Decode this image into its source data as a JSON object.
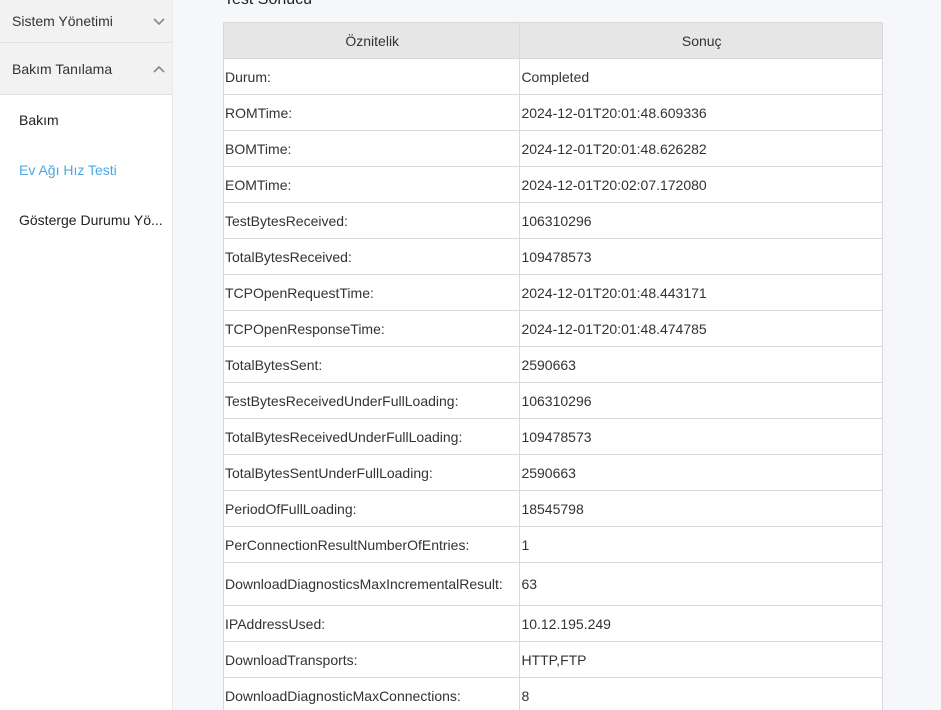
{
  "sidebar": {
    "groups": [
      {
        "label": "Sistem Yönetimi",
        "expanded": false,
        "icon": "chevron-down-icon"
      },
      {
        "label": "Bakım Tanılama",
        "expanded": true,
        "icon": "chevron-up-icon"
      }
    ],
    "items": [
      {
        "label": "Bakım",
        "active": false
      },
      {
        "label": "Ev Ağı Hız Testi",
        "active": true
      },
      {
        "label": "Gösterge Durumu Yö..."
      }
    ]
  },
  "main": {
    "section_title": "Test Sonucu",
    "table": {
      "headers": [
        "Öznitelik",
        "Sonuç"
      ],
      "rows": [
        {
          "attr": "Durum:",
          "value": "Completed"
        },
        {
          "attr": "ROMTime:",
          "value": "2024-12-01T20:01:48.609336"
        },
        {
          "attr": "BOMTime:",
          "value": "2024-12-01T20:01:48.626282"
        },
        {
          "attr": "EOMTime:",
          "value": "2024-12-01T20:02:07.172080"
        },
        {
          "attr": "TestBytesReceived:",
          "value": "106310296"
        },
        {
          "attr": "TotalBytesReceived:",
          "value": "109478573"
        },
        {
          "attr": "TCPOpenRequestTime:",
          "value": "2024-12-01T20:01:48.443171"
        },
        {
          "attr": "TCPOpenResponseTime:",
          "value": "2024-12-01T20:01:48.474785"
        },
        {
          "attr": "TotalBytesSent:",
          "value": "2590663"
        },
        {
          "attr": "TestBytesReceivedUnderFullLoading:",
          "value": "106310296"
        },
        {
          "attr": "TotalBytesReceivedUnderFullLoading:",
          "value": "109478573"
        },
        {
          "attr": "TotalBytesSentUnderFullLoading:",
          "value": "2590663"
        },
        {
          "attr": "PeriodOfFullLoading:",
          "value": "18545798"
        },
        {
          "attr": "PerConnectionResultNumberOfEntries:",
          "value": "1"
        },
        {
          "attr": "DownloadDiagnosticsMaxIncrementalResult:",
          "value": "63"
        },
        {
          "attr": "IPAddressUsed:",
          "value": "10.12.195.249"
        },
        {
          "attr": "DownloadTransports:",
          "value": "HTTP,FTP"
        },
        {
          "attr": "DownloadDiagnosticMaxConnections:",
          "value": "8"
        }
      ]
    }
  },
  "colors": {
    "accent": "#4aa8e0",
    "sidebar_group_bg": "#f2f2f2",
    "table_header_bg": "#e6e6e6",
    "page_bg": "#f5f7fa"
  }
}
